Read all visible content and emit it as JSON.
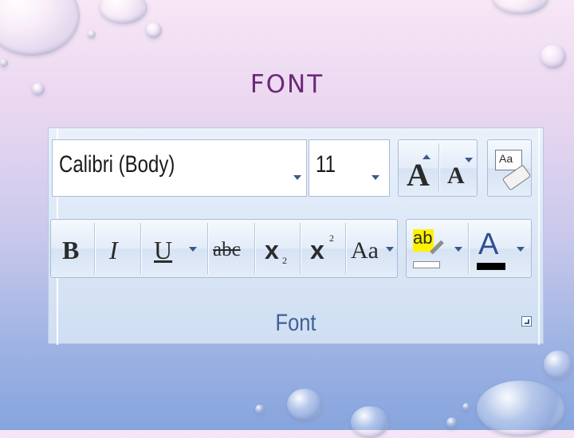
{
  "slide": {
    "title": "FONT"
  },
  "ribbon": {
    "font_name": "Calibri (Body)",
    "font_size": "11",
    "grow_font_label": "A",
    "shrink_font_label": "A",
    "clear_format_label": "Aa",
    "bold_label": "B",
    "italic_label": "I",
    "underline_label": "U",
    "strike_label": "abc",
    "subscript_label": "x",
    "subscript_sub": "2",
    "superscript_label": "x",
    "superscript_sup": "2",
    "change_case_label": "Aa",
    "highlight_label": "ab",
    "font_color_label": "A",
    "group_label": "Font"
  },
  "colors": {
    "title": "#6b2a7a",
    "highlight_swatch": "#ffffff",
    "font_color_swatch": "#000000",
    "group_label": "#3f5f94"
  }
}
